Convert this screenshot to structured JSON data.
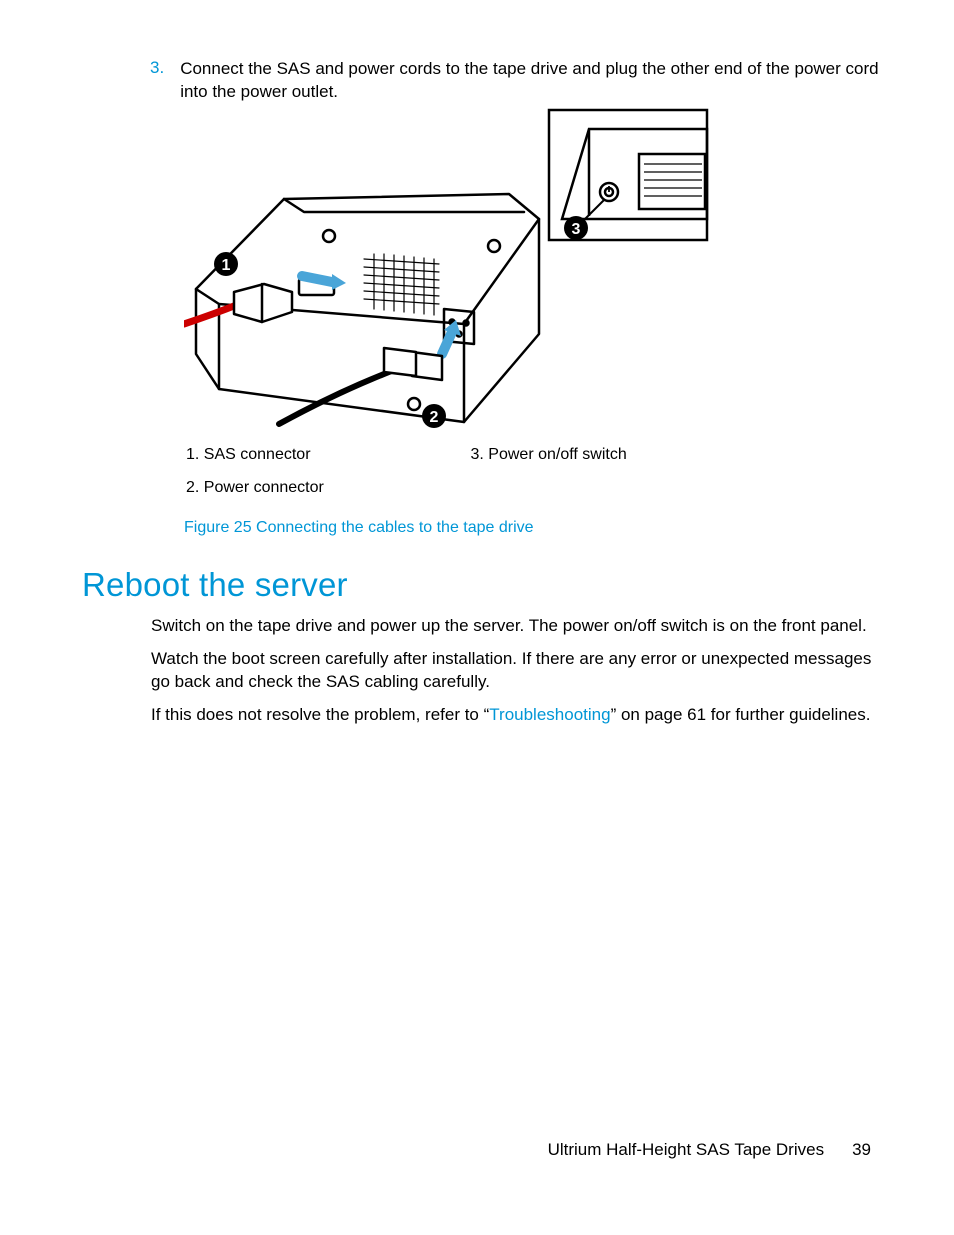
{
  "step": {
    "number": "3.",
    "text": "Connect the SAS and power cords to the tape drive and plug the other end of the power cord into the power outlet."
  },
  "legend": {
    "item1": "1. SAS connector",
    "item2": "2. Power connector",
    "item3": "3. Power on/off switch"
  },
  "figure_caption": "Figure 25 Connecting the cables to the tape drive",
  "section_heading": "Reboot the server",
  "paragraphs": {
    "p1": "Switch on the tape drive and power up the server. The power on/off switch is on the front panel.",
    "p2": "Watch the boot screen carefully after installation. If there are any error or unexpected messages go back and check the SAS cabling carefully.",
    "p3a": "If this does not resolve the problem, refer to “",
    "p3link": "Troubleshooting",
    "p3b": "” on page 61 for further guidelines."
  },
  "footer": {
    "title": "Ultrium Half-Height SAS Tape Drives",
    "page": "39"
  },
  "callouts": {
    "c1": "1",
    "c2": "2",
    "c3": "3"
  }
}
